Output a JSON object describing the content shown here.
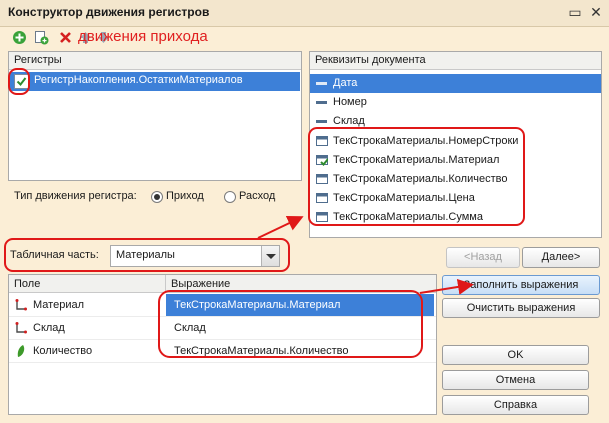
{
  "window": {
    "title": "Конструктор движения регистров",
    "minimize_glyph": "▭",
    "close_glyph": "✕"
  },
  "toolbar": {
    "icons": [
      "add-icon",
      "add-copy-icon",
      "delete-icon",
      "move-up-icon",
      "move-down-icon"
    ],
    "annotation": "движения прихода"
  },
  "registers": {
    "header": "Регистры",
    "items": [
      {
        "label": "РегистрНакопления.ОстаткиМатериалов",
        "selected": true,
        "checked": true
      }
    ]
  },
  "doc_attrs": {
    "header": "Реквизиты документа",
    "items": [
      {
        "label": "Дата",
        "icon": "dash",
        "selected": true
      },
      {
        "label": "Номер",
        "icon": "dash"
      },
      {
        "label": "Склад",
        "icon": "dash"
      },
      {
        "label": "ТекСтрокаМатериалы.НомерСтроки",
        "icon": "table-attr"
      },
      {
        "label": "ТекСтрокаМатериалы.Материал",
        "icon": "table-attr-used"
      },
      {
        "label": "ТекСтрокаМатериалы.Количество",
        "icon": "table-attr"
      },
      {
        "label": "ТекСтрокаМатериалы.Цена",
        "icon": "table-attr"
      },
      {
        "label": "ТекСтрокаМатериалы.Сумма",
        "icon": "table-attr"
      }
    ]
  },
  "movement_type": {
    "label": "Тип движения регистра:",
    "options": [
      "Приход",
      "Расход"
    ],
    "selected": "Приход"
  },
  "tabular": {
    "label": "Табличная часть:",
    "value": "Материалы"
  },
  "nav": {
    "back": "<Назад",
    "next": "Далее>"
  },
  "grid": {
    "columns": [
      "Поле",
      "Выражение"
    ],
    "rows": [
      {
        "field": "Материал",
        "expr": "ТекСтрокаМатериалы.Материал",
        "icon": "reference-icon",
        "selected": true
      },
      {
        "field": "Склад",
        "expr": "Склад",
        "icon": "reference-icon"
      },
      {
        "field": "Количество",
        "expr": "ТекСтрокаМатериалы.Количество",
        "icon": "number-icon"
      }
    ]
  },
  "actions": {
    "fill": "Заполнить выражения",
    "clear": "Очистить выражения",
    "ok": "OK",
    "cancel": "Отмена",
    "help": "Справка"
  },
  "colors": {
    "window_bg": "#fbeed6",
    "selection": "#3d80d8",
    "annotation": "#e01818"
  }
}
